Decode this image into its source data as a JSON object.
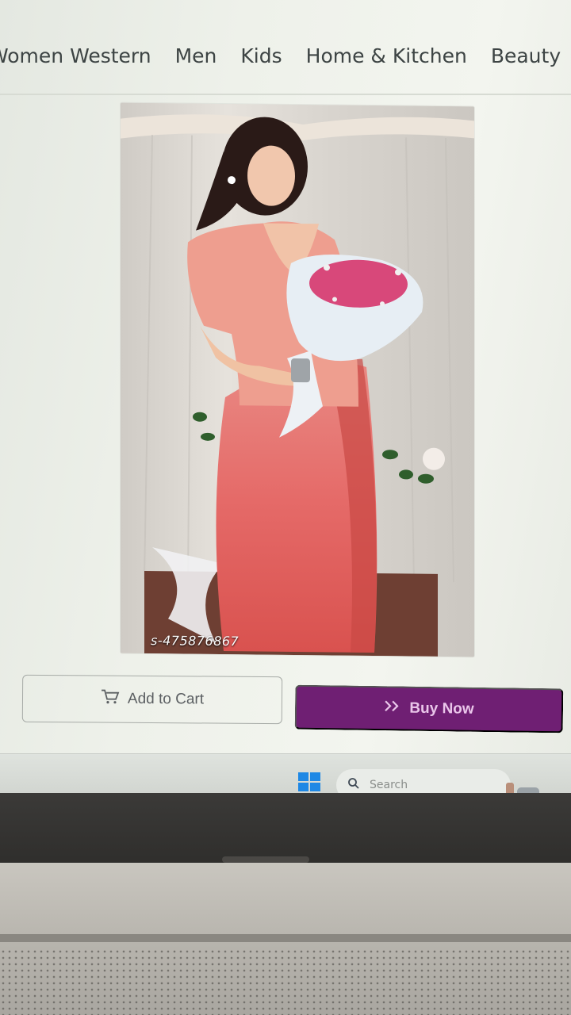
{
  "nav": {
    "items": [
      "Women Western",
      "Men",
      "Kids",
      "Home & Kitchen",
      "Beauty"
    ]
  },
  "product": {
    "image_icon": "saree-product-photo",
    "sku": "s-475876867"
  },
  "actions": {
    "add_to_cart_label": "Add to Cart",
    "add_to_cart_icon": "cart-icon",
    "buy_now_label": "Buy Now",
    "buy_now_icon": "double-chevron-right-icon"
  },
  "taskbar": {
    "search_placeholder": "Search",
    "start_icon": "windows-start-icon",
    "search_icon": "search-icon"
  },
  "colors": {
    "buy_now_bg": "#6f1f73",
    "screen_bg": "#eef1ea",
    "nav_text": "#3d4444"
  }
}
